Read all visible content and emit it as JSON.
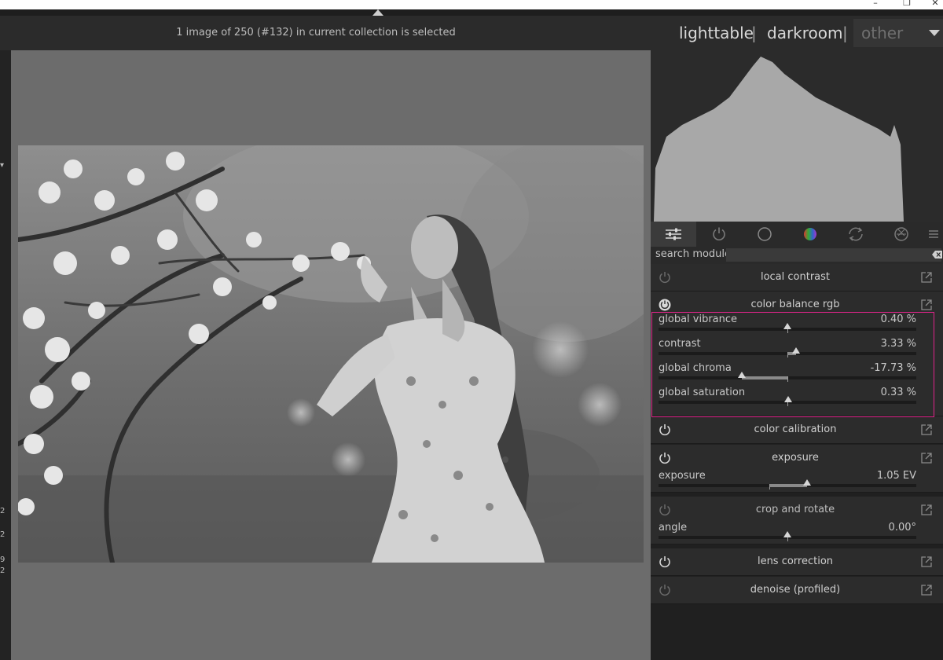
{
  "window": {
    "minimize_glyph": "–",
    "restore_glyph": "❐",
    "close_glyph": "✕"
  },
  "header": {
    "status": "1 image of 250 (#132) in current collection is selected"
  },
  "views": {
    "lighttable": "lighttable",
    "darkroom": "darkroom",
    "other": "other",
    "separator": "|"
  },
  "left_strip": {
    "marks": [
      "2",
      "2",
      "9",
      "2"
    ]
  },
  "module_tabs": [
    {
      "name": "tab-active-modules",
      "icon": "sliders-icon"
    },
    {
      "name": "tab-power",
      "icon": "power-icon"
    },
    {
      "name": "tab-base",
      "icon": "circle-icon"
    },
    {
      "name": "tab-color",
      "icon": "color-wheel-icon"
    },
    {
      "name": "tab-correct",
      "icon": "rotate-arrows-icon"
    },
    {
      "name": "tab-effects",
      "icon": "aperture-icon"
    },
    {
      "name": "tab-presets-menu",
      "icon": "hamburger-menu-icon"
    }
  ],
  "search": {
    "label": "search module",
    "placeholder": ""
  },
  "modules": {
    "local_contrast": {
      "title": "local contrast",
      "enabled": false
    },
    "color_balance_rgb": {
      "title": "color balance rgb",
      "enabled": true,
      "sliders": [
        {
          "label": "global vibrance",
          "value": "0.40 %",
          "fraction": 0.501,
          "zero": 0.5
        },
        {
          "label": "contrast",
          "value": "3.33 %",
          "fraction": 0.533,
          "zero": 0.5
        },
        {
          "label": "global chroma",
          "value": "-17.73 %",
          "fraction": 0.323,
          "zero": 0.5
        },
        {
          "label": "global saturation",
          "value": "0.33 %",
          "fraction": 0.503,
          "zero": 0.5
        }
      ]
    },
    "color_calibration": {
      "title": "color calibration",
      "enabled": true
    },
    "exposure": {
      "title": "exposure",
      "enabled": true,
      "sliders": [
        {
          "label": "exposure",
          "value": "1.05 EV",
          "fraction": 0.575,
          "zero": 0.43
        }
      ]
    },
    "crop_and_rotate": {
      "title": "crop and rotate",
      "enabled": false,
      "sliders": [
        {
          "label": "angle",
          "value": "0.00°",
          "fraction": 0.5,
          "zero": 0.5
        }
      ]
    },
    "lens_correction": {
      "title": "lens correction",
      "enabled": true
    },
    "denoise_profiled": {
      "title": "denoise (profiled)",
      "enabled": false
    }
  },
  "colors": {
    "accent_highlight": "#e0248a",
    "panel_bg": "#2c2c2c",
    "canvas_bg": "#6c6c6c"
  }
}
